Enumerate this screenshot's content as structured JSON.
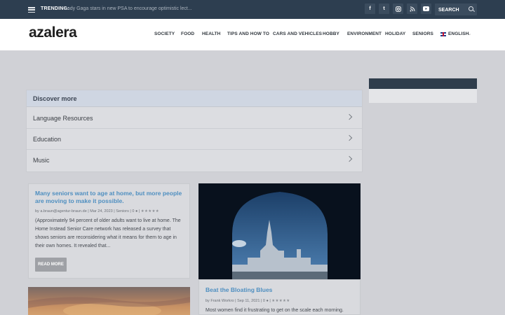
{
  "topbar": {
    "trending_label": "TRENDING:",
    "trending_text": "Lady Gaga stars in new PSA to encourage optimistic lect...",
    "social_icons": [
      "facebook-icon",
      "twitter-icon",
      "instagram-icon",
      "rss-icon",
      "youtube-icon"
    ],
    "search_placeholder": "SEARCH"
  },
  "header": {
    "logo": "azalera",
    "nav": [
      "SOCIETY",
      "FOOD",
      "HEALTH",
      "TIPS AND HOW TO",
      "CARS AND VEHICLES",
      "HOBBY",
      "ENVIRONMENT",
      "HOLIDAY",
      "SENIORS"
    ],
    "language": "ENGLISH"
  },
  "discover": {
    "title": "Discover more",
    "items": [
      "Language Resources",
      "Education",
      "Music"
    ]
  },
  "posts": [
    {
      "title": "Many seniors want to age at home, but more people are moving to make it possible.",
      "author": "a.braun@agentur-braun.de",
      "date": "Mar 24, 2023",
      "category": "Seniors",
      "comments": "0",
      "excerpt": "(Approximately 94 percent of older adults want to live at home. The Home Instead Senior Care network has released a survey that shows seniors are reconsidering what it means for them to age in their own homes. It revealed that...",
      "read_more": "READ MORE"
    },
    {
      "title": "Beat the Bloating Blues",
      "author": "Frank Workro",
      "date": "Sep 11, 2021",
      "comments": "0",
      "excerpt": "Most women find it frustrating to get on the scale each morning."
    }
  ],
  "colors": {
    "topbar": "#2d3e50",
    "accent_title": "#4f8fc0",
    "overlay_bg": "#d0d1d6"
  }
}
